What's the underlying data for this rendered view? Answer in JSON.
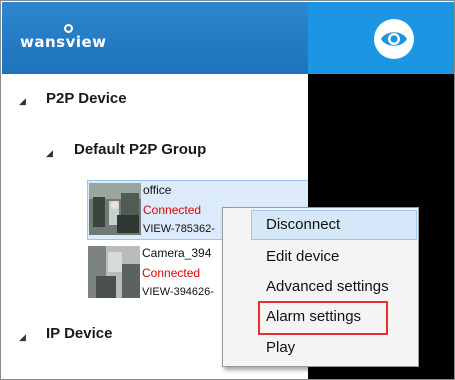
{
  "app": {
    "logo_text": "wansview",
    "preview_button": "eye-icon"
  },
  "tree": {
    "groups": [
      {
        "label": "P2P Device"
      },
      {
        "label": "Default P2P Group"
      },
      {
        "label": "IP Device"
      }
    ],
    "devices": [
      {
        "name": "office",
        "status": "Connected",
        "id": "VIEW-785362-"
      },
      {
        "name": "Camera_394",
        "status": "Connected",
        "id": "VIEW-394626-"
      }
    ]
  },
  "context_menu": {
    "items": [
      {
        "label": "Disconnect"
      },
      {
        "label": "Edit device"
      },
      {
        "label": "Advanced settings"
      },
      {
        "label": "Alarm settings"
      },
      {
        "label": "Play"
      }
    ],
    "highlighted": "Alarm settings"
  },
  "colors": {
    "header_blue": "#1d72bb",
    "header_accent": "#1c95e2",
    "status_connected": "#e00000",
    "highlight_border": "#e53030"
  }
}
